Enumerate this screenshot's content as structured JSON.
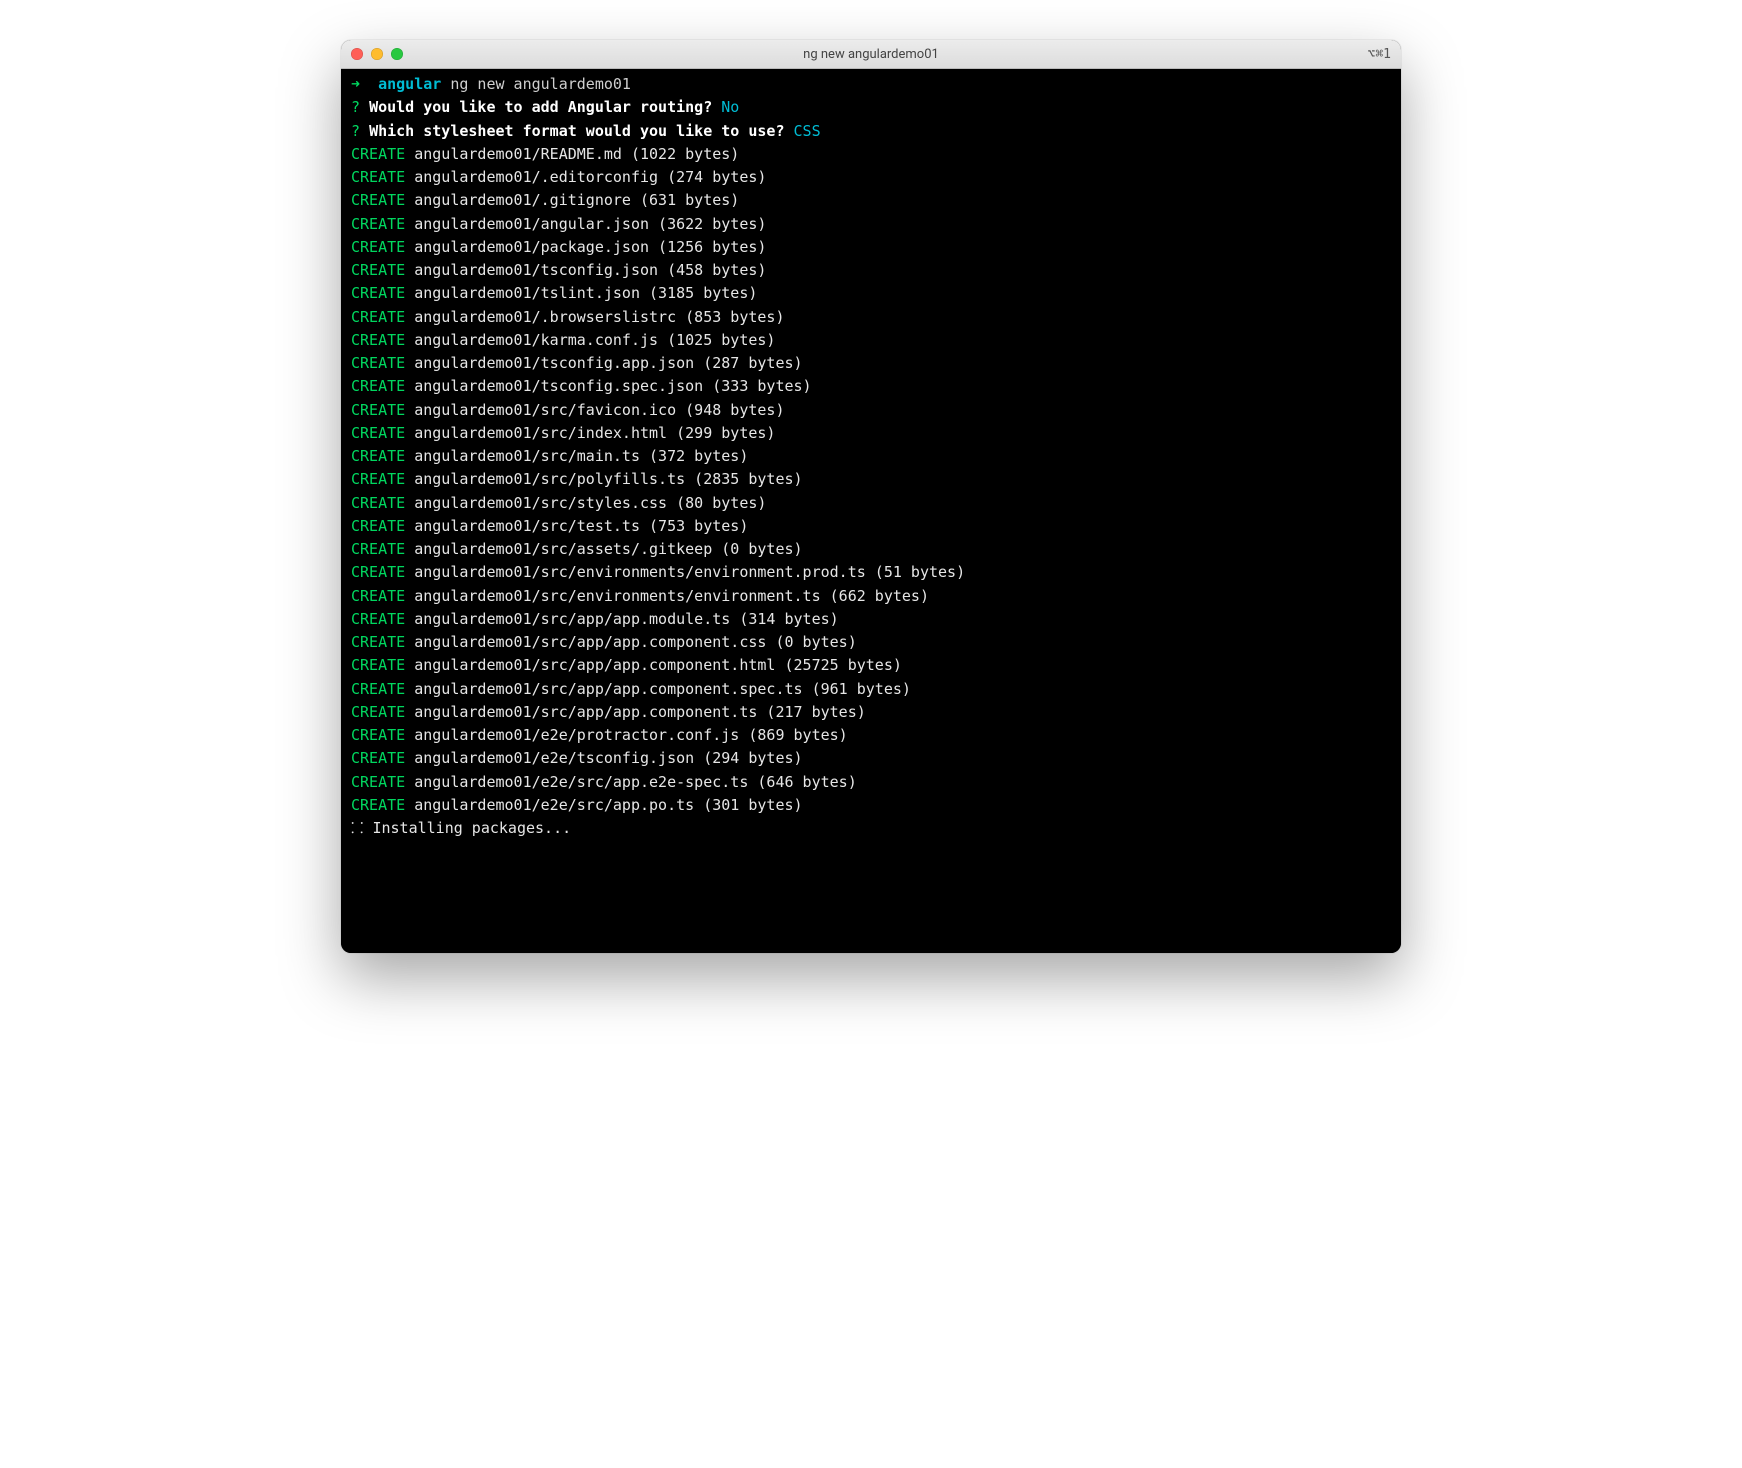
{
  "window": {
    "title": "ng new angulardemo01",
    "shortcut": "⌥⌘1"
  },
  "prompt": {
    "arrow": "➜",
    "context": "angular",
    "command": "ng new angulardemo01"
  },
  "questions": [
    {
      "mark": "?",
      "text": "Would you like to add Angular routing?",
      "answer": "No"
    },
    {
      "mark": "?",
      "text": "Which stylesheet format would you like to use?",
      "answer": "CSS"
    }
  ],
  "creates": [
    {
      "path": "angulardemo01/README.md",
      "size": "1022 bytes"
    },
    {
      "path": "angulardemo01/.editorconfig",
      "size": "274 bytes"
    },
    {
      "path": "angulardemo01/.gitignore",
      "size": "631 bytes"
    },
    {
      "path": "angulardemo01/angular.json",
      "size": "3622 bytes"
    },
    {
      "path": "angulardemo01/package.json",
      "size": "1256 bytes"
    },
    {
      "path": "angulardemo01/tsconfig.json",
      "size": "458 bytes"
    },
    {
      "path": "angulardemo01/tslint.json",
      "size": "3185 bytes"
    },
    {
      "path": "angulardemo01/.browserslistrc",
      "size": "853 bytes"
    },
    {
      "path": "angulardemo01/karma.conf.js",
      "size": "1025 bytes"
    },
    {
      "path": "angulardemo01/tsconfig.app.json",
      "size": "287 bytes"
    },
    {
      "path": "angulardemo01/tsconfig.spec.json",
      "size": "333 bytes"
    },
    {
      "path": "angulardemo01/src/favicon.ico",
      "size": "948 bytes"
    },
    {
      "path": "angulardemo01/src/index.html",
      "size": "299 bytes"
    },
    {
      "path": "angulardemo01/src/main.ts",
      "size": "372 bytes"
    },
    {
      "path": "angulardemo01/src/polyfills.ts",
      "size": "2835 bytes"
    },
    {
      "path": "angulardemo01/src/styles.css",
      "size": "80 bytes"
    },
    {
      "path": "angulardemo01/src/test.ts",
      "size": "753 bytes"
    },
    {
      "path": "angulardemo01/src/assets/.gitkeep",
      "size": "0 bytes"
    },
    {
      "path": "angulardemo01/src/environments/environment.prod.ts",
      "size": "51 bytes"
    },
    {
      "path": "angulardemo01/src/environments/environment.ts",
      "size": "662 bytes"
    },
    {
      "path": "angulardemo01/src/app/app.module.ts",
      "size": "314 bytes"
    },
    {
      "path": "angulardemo01/src/app/app.component.css",
      "size": "0 bytes"
    },
    {
      "path": "angulardemo01/src/app/app.component.html",
      "size": "25725 bytes"
    },
    {
      "path": "angulardemo01/src/app/app.component.spec.ts",
      "size": "961 bytes"
    },
    {
      "path": "angulardemo01/src/app/app.component.ts",
      "size": "217 bytes"
    },
    {
      "path": "angulardemo01/e2e/protractor.conf.js",
      "size": "869 bytes"
    },
    {
      "path": "angulardemo01/e2e/tsconfig.json",
      "size": "294 bytes"
    },
    {
      "path": "angulardemo01/e2e/src/app.e2e-spec.ts",
      "size": "646 bytes"
    },
    {
      "path": "angulardemo01/e2e/src/app.po.ts",
      "size": "301 bytes"
    }
  ],
  "status": {
    "spinner": "⸬",
    "text": "Installing packages..."
  },
  "labels": {
    "create": "CREATE"
  }
}
